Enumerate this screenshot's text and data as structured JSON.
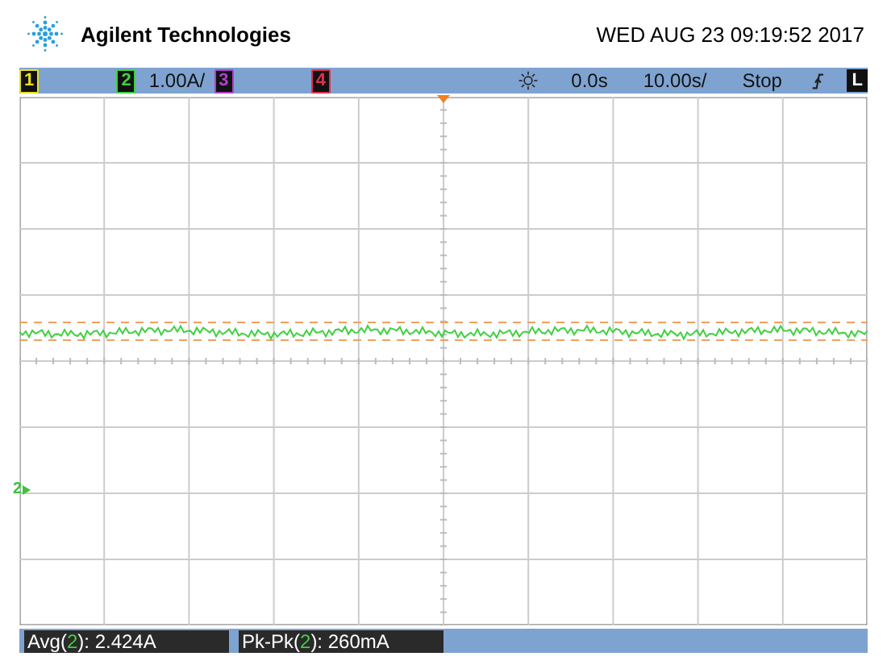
{
  "header": {
    "brand": "Agilent Technologies",
    "datetime": "WED AUG 23 09:19:52 2017"
  },
  "status_bar": {
    "channels": [
      {
        "number": "1",
        "color": "#e8e020"
      },
      {
        "number": "2",
        "color": "#40d040",
        "scale": "1.00A/"
      },
      {
        "number": "3",
        "color": "#b040d0"
      },
      {
        "number": "4",
        "color": "#e03050"
      }
    ],
    "delay": "0.0s",
    "timebase": "10.00s/",
    "run_state": "Stop",
    "trigger_mode": "L"
  },
  "ground_marker": {
    "label": "2"
  },
  "measurements": [
    {
      "prefix": "Avg(",
      "channel": "2",
      "suffix": "): 2.424A"
    },
    {
      "prefix": "Pk-Pk(",
      "channel": "2",
      "suffix": "): 260mA"
    }
  ]
}
